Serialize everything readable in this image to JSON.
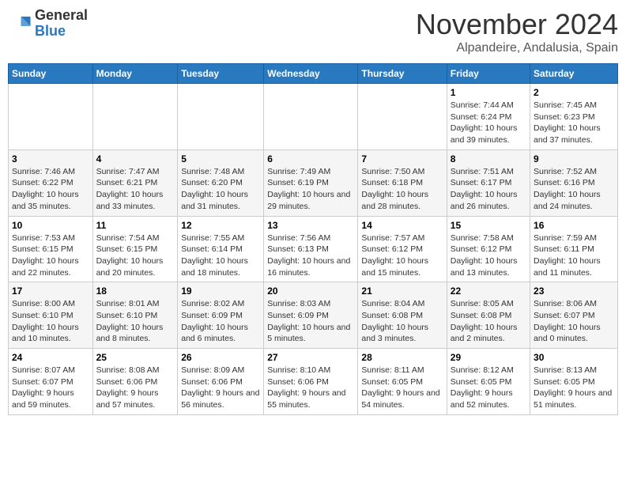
{
  "header": {
    "logo_general": "General",
    "logo_blue": "Blue",
    "month": "November 2024",
    "location": "Alpandeire, Andalusia, Spain"
  },
  "days_of_week": [
    "Sunday",
    "Monday",
    "Tuesday",
    "Wednesday",
    "Thursday",
    "Friday",
    "Saturday"
  ],
  "weeks": [
    [
      {
        "day": "",
        "info": ""
      },
      {
        "day": "",
        "info": ""
      },
      {
        "day": "",
        "info": ""
      },
      {
        "day": "",
        "info": ""
      },
      {
        "day": "",
        "info": ""
      },
      {
        "day": "1",
        "info": "Sunrise: 7:44 AM\nSunset: 6:24 PM\nDaylight: 10 hours and 39 minutes."
      },
      {
        "day": "2",
        "info": "Sunrise: 7:45 AM\nSunset: 6:23 PM\nDaylight: 10 hours and 37 minutes."
      }
    ],
    [
      {
        "day": "3",
        "info": "Sunrise: 7:46 AM\nSunset: 6:22 PM\nDaylight: 10 hours and 35 minutes."
      },
      {
        "day": "4",
        "info": "Sunrise: 7:47 AM\nSunset: 6:21 PM\nDaylight: 10 hours and 33 minutes."
      },
      {
        "day": "5",
        "info": "Sunrise: 7:48 AM\nSunset: 6:20 PM\nDaylight: 10 hours and 31 minutes."
      },
      {
        "day": "6",
        "info": "Sunrise: 7:49 AM\nSunset: 6:19 PM\nDaylight: 10 hours and 29 minutes."
      },
      {
        "day": "7",
        "info": "Sunrise: 7:50 AM\nSunset: 6:18 PM\nDaylight: 10 hours and 28 minutes."
      },
      {
        "day": "8",
        "info": "Sunrise: 7:51 AM\nSunset: 6:17 PM\nDaylight: 10 hours and 26 minutes."
      },
      {
        "day": "9",
        "info": "Sunrise: 7:52 AM\nSunset: 6:16 PM\nDaylight: 10 hours and 24 minutes."
      }
    ],
    [
      {
        "day": "10",
        "info": "Sunrise: 7:53 AM\nSunset: 6:15 PM\nDaylight: 10 hours and 22 minutes."
      },
      {
        "day": "11",
        "info": "Sunrise: 7:54 AM\nSunset: 6:15 PM\nDaylight: 10 hours and 20 minutes."
      },
      {
        "day": "12",
        "info": "Sunrise: 7:55 AM\nSunset: 6:14 PM\nDaylight: 10 hours and 18 minutes."
      },
      {
        "day": "13",
        "info": "Sunrise: 7:56 AM\nSunset: 6:13 PM\nDaylight: 10 hours and 16 minutes."
      },
      {
        "day": "14",
        "info": "Sunrise: 7:57 AM\nSunset: 6:12 PM\nDaylight: 10 hours and 15 minutes."
      },
      {
        "day": "15",
        "info": "Sunrise: 7:58 AM\nSunset: 6:12 PM\nDaylight: 10 hours and 13 minutes."
      },
      {
        "day": "16",
        "info": "Sunrise: 7:59 AM\nSunset: 6:11 PM\nDaylight: 10 hours and 11 minutes."
      }
    ],
    [
      {
        "day": "17",
        "info": "Sunrise: 8:00 AM\nSunset: 6:10 PM\nDaylight: 10 hours and 10 minutes."
      },
      {
        "day": "18",
        "info": "Sunrise: 8:01 AM\nSunset: 6:10 PM\nDaylight: 10 hours and 8 minutes."
      },
      {
        "day": "19",
        "info": "Sunrise: 8:02 AM\nSunset: 6:09 PM\nDaylight: 10 hours and 6 minutes."
      },
      {
        "day": "20",
        "info": "Sunrise: 8:03 AM\nSunset: 6:09 PM\nDaylight: 10 hours and 5 minutes."
      },
      {
        "day": "21",
        "info": "Sunrise: 8:04 AM\nSunset: 6:08 PM\nDaylight: 10 hours and 3 minutes."
      },
      {
        "day": "22",
        "info": "Sunrise: 8:05 AM\nSunset: 6:08 PM\nDaylight: 10 hours and 2 minutes."
      },
      {
        "day": "23",
        "info": "Sunrise: 8:06 AM\nSunset: 6:07 PM\nDaylight: 10 hours and 0 minutes."
      }
    ],
    [
      {
        "day": "24",
        "info": "Sunrise: 8:07 AM\nSunset: 6:07 PM\nDaylight: 9 hours and 59 minutes."
      },
      {
        "day": "25",
        "info": "Sunrise: 8:08 AM\nSunset: 6:06 PM\nDaylight: 9 hours and 57 minutes."
      },
      {
        "day": "26",
        "info": "Sunrise: 8:09 AM\nSunset: 6:06 PM\nDaylight: 9 hours and 56 minutes."
      },
      {
        "day": "27",
        "info": "Sunrise: 8:10 AM\nSunset: 6:06 PM\nDaylight: 9 hours and 55 minutes."
      },
      {
        "day": "28",
        "info": "Sunrise: 8:11 AM\nSunset: 6:05 PM\nDaylight: 9 hours and 54 minutes."
      },
      {
        "day": "29",
        "info": "Sunrise: 8:12 AM\nSunset: 6:05 PM\nDaylight: 9 hours and 52 minutes."
      },
      {
        "day": "30",
        "info": "Sunrise: 8:13 AM\nSunset: 6:05 PM\nDaylight: 9 hours and 51 minutes."
      }
    ]
  ]
}
